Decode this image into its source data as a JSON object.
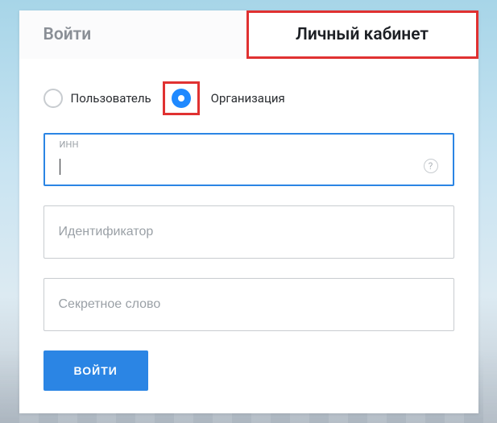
{
  "tabs": {
    "login": "Войти",
    "cabinet": "Личный кабинет"
  },
  "account_type": {
    "user_label": "Пользователь",
    "org_label": "Организация",
    "selected": "org"
  },
  "fields": {
    "inn": {
      "float_label": "ИНН",
      "value": ""
    },
    "identifier": {
      "placeholder": "Идентификатор"
    },
    "secret": {
      "placeholder": "Секретное слово"
    }
  },
  "submit_label": "ВОЙТИ"
}
